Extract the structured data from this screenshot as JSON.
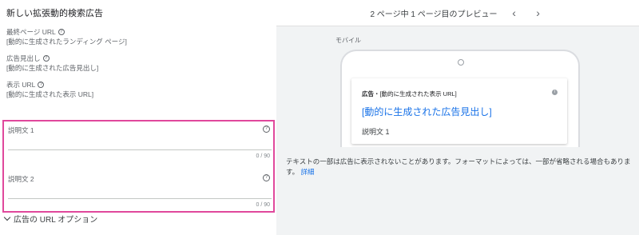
{
  "form": {
    "title": "新しい拡張動的検索広告",
    "final_url": {
      "label": "最終ページ URL",
      "value": "[動的に生成されたランディング ページ]"
    },
    "headline": {
      "label": "広告見出し",
      "value": "[動的に生成された広告見出し]"
    },
    "display_url": {
      "label": "表示 URL",
      "value": "[動的に生成された表示 URL]"
    },
    "description1": {
      "label": "説明文 1",
      "value": "",
      "counter": "0 / 90"
    },
    "description2": {
      "label": "説明文 2",
      "value": "",
      "counter": "0 / 90"
    },
    "url_options_label": "広告の URL オプション",
    "highlight_color": "#e0489c"
  },
  "preview": {
    "header_text": "2 ページ中 1 ページ目のプレビュー",
    "prev_icon": "chevron-left-icon",
    "next_icon": "chevron-right-icon",
    "device_label": "モバイル",
    "ad": {
      "badge": "広告",
      "separator": "・",
      "display_url": "[動的に生成された表示 URL]",
      "headline": "[動的に生成された広告見出し]",
      "description": "説明文 1"
    },
    "notice_text": "テキストの一部は広告に表示されないことがあります。フォーマットによっては、一部が省略される場合もあります。",
    "details_link": "詳細"
  }
}
